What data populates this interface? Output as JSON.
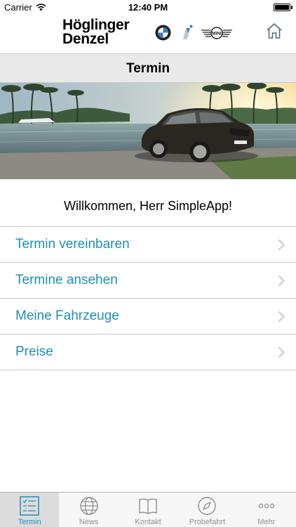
{
  "status_bar": {
    "carrier": "Carrier",
    "time": "12:40 PM"
  },
  "header": {
    "logo_line1": "Höglinger",
    "logo_line2": "Denzel",
    "home_icon": "home-icon"
  },
  "nav": {
    "title": "Termin"
  },
  "welcome_text": "Willkommen, Herr SimpleApp!",
  "menu": {
    "items": [
      {
        "label": "Termin vereinbaren"
      },
      {
        "label": "Termine ansehen"
      },
      {
        "label": "Meine Fahrzeuge"
      },
      {
        "label": "Preise"
      }
    ]
  },
  "tab_bar": {
    "tabs": [
      {
        "label": "Termin",
        "icon": "list-icon",
        "active": true
      },
      {
        "label": "News",
        "icon": "globe-icon",
        "active": false
      },
      {
        "label": "Kontakt",
        "icon": "book-icon",
        "active": false
      },
      {
        "label": "Probefahrt",
        "icon": "compass-icon",
        "active": false
      },
      {
        "label": "Mehr",
        "icon": "more-icon",
        "active": false
      }
    ]
  },
  "colors": {
    "accent": "#1f8fb3",
    "nav_background": "#e9e9ea",
    "separator": "#c8c7cc"
  }
}
